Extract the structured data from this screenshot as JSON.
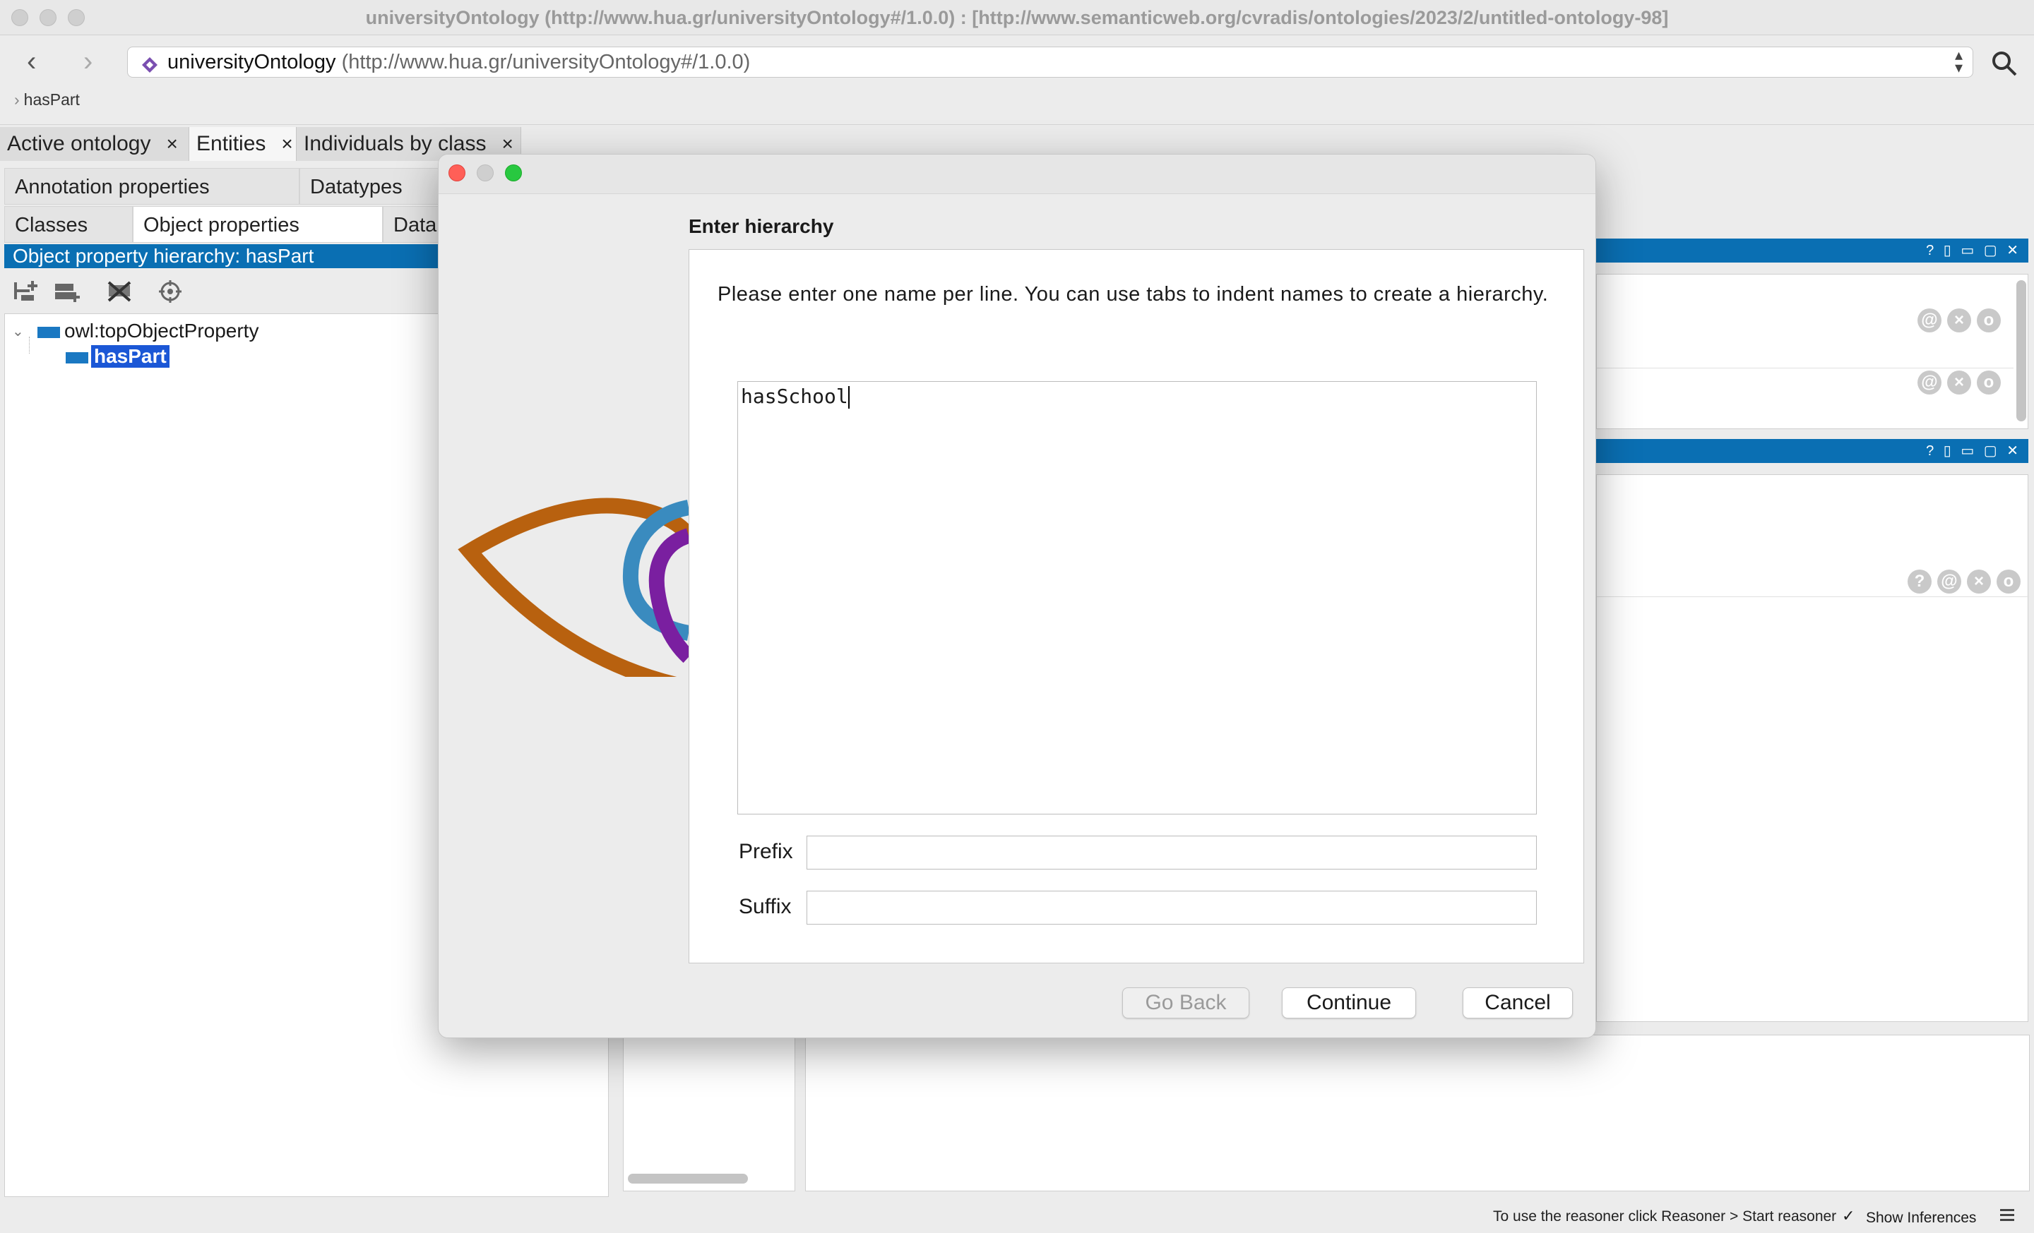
{
  "window": {
    "title": "universityOntology (http://www.hua.gr/universityOntology#/1.0.0)  : [http://www.semanticweb.org/cvradis/ontologies/2023/2/untitled-ontology-98]"
  },
  "nav": {
    "back_glyph": "‹",
    "forward_glyph": "›",
    "ontology_name": "universityOntology",
    "ontology_iri": "(http://www.hua.gr/universityOntology#/1.0.0)",
    "breadcrumb": "hasPart"
  },
  "tabs": [
    {
      "label": "Active ontology",
      "close": "×"
    },
    {
      "label": "Entities",
      "close": "×"
    },
    {
      "label": "Individuals by class",
      "close": "×"
    }
  ],
  "entity_tabs": {
    "row1": [
      "Annotation properties",
      "Datatypes"
    ],
    "row2": [
      "Classes",
      "Object properties",
      "Data"
    ]
  },
  "hierarchy": {
    "title": "Object property hierarchy: hasPart",
    "root": "owl:topObjectProperty",
    "child": "hasPart"
  },
  "right_panels": {
    "mini_controls": "? ▯ ▭ ▢ ✕",
    "circle_icons": [
      "@",
      "×",
      "o"
    ],
    "circle_icons_3": [
      "?",
      "@",
      "×",
      "o"
    ]
  },
  "dialog": {
    "heading": "Enter hierarchy",
    "instructions": "Please enter one name per line. You can use tabs to indent names to create a hierarchy.",
    "names_text": "hasSchool",
    "prefix_label": "Prefix",
    "prefix_value": "",
    "suffix_label": "Suffix",
    "suffix_value": "",
    "go_back": "Go Back",
    "continue": "Continue",
    "cancel": "Cancel"
  },
  "status": {
    "reasoner_hint": "To use the reasoner click Reasoner > Start reasoner",
    "show_inferences": "Show Inferences",
    "checkbox_checked": true
  },
  "colors": {
    "selection_blue": "#0a6fb3",
    "highlight": "#1b57d6",
    "logo_orange": "#b8610f",
    "logo_blue": "#3a8bbf",
    "logo_purple": "#7a1fa0"
  }
}
